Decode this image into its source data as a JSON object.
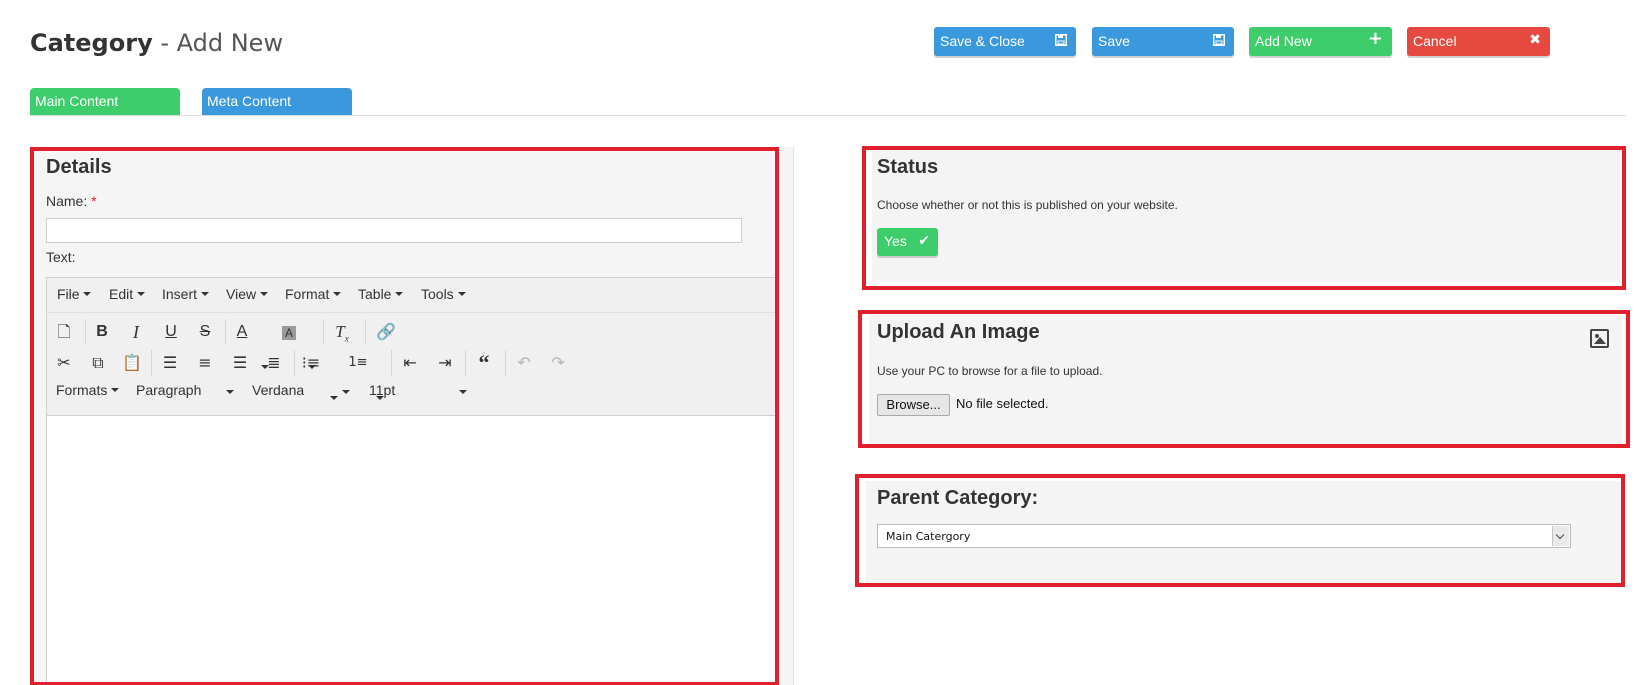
{
  "page_title": {
    "main": "Category",
    "suffix": " - Add New"
  },
  "header_buttons": [
    {
      "label": "Save & Close",
      "icon": "floppy-icon",
      "color": "#3a98dc"
    },
    {
      "label": "Save",
      "icon": "floppy-icon",
      "color": "#3a98dc"
    },
    {
      "label": "Add New",
      "icon": "plus-icon",
      "color": "#3dcd6a"
    },
    {
      "label": "Cancel",
      "icon": "close-icon",
      "color": "#e5493f"
    }
  ],
  "tabs": [
    {
      "label": "Main Content",
      "color": "#3dcd6a"
    },
    {
      "label": "Meta Content",
      "color": "#3a98dc"
    }
  ],
  "details": {
    "title": "Details",
    "name_label": "Name:",
    "required_mark": "*",
    "name_value": "",
    "text_label": "Text:",
    "editor": {
      "menus": [
        "File",
        "Edit",
        "Insert",
        "View",
        "Format",
        "Table",
        "Tools"
      ],
      "formats_label": "Formats",
      "block_format": "Paragraph",
      "font_family": "Verdana",
      "font_size": "11pt",
      "toolbar_icons": [
        "new-document-icon",
        "bold-icon",
        "italic-icon",
        "underline-icon",
        "strikethrough-icon",
        "text-color-icon",
        "background-color-icon",
        "clear-formatting-icon",
        "link-icon",
        "cut-icon",
        "copy-icon",
        "paste-icon",
        "align-left-icon",
        "align-center-icon",
        "align-right-icon",
        "justify-icon",
        "bullet-list-icon",
        "numbered-list-icon",
        "outdent-icon",
        "indent-icon",
        "blockquote-icon",
        "undo-icon",
        "redo-icon"
      ]
    }
  },
  "status": {
    "title": "Status",
    "description": "Choose whether or not this is published on your website.",
    "toggle_label": "Yes",
    "toggle_color": "#3dcd6a"
  },
  "upload": {
    "title": "Upload An Image",
    "description": "Use your PC to browse for a file to upload.",
    "browse_label": "Browse...",
    "file_status": "No file selected."
  },
  "parent_category": {
    "title": "Parent Category:",
    "selected": "Main Catergory"
  },
  "colors": {
    "highlight_border": "#e0202d",
    "panel_background": "#f4f4f4"
  }
}
